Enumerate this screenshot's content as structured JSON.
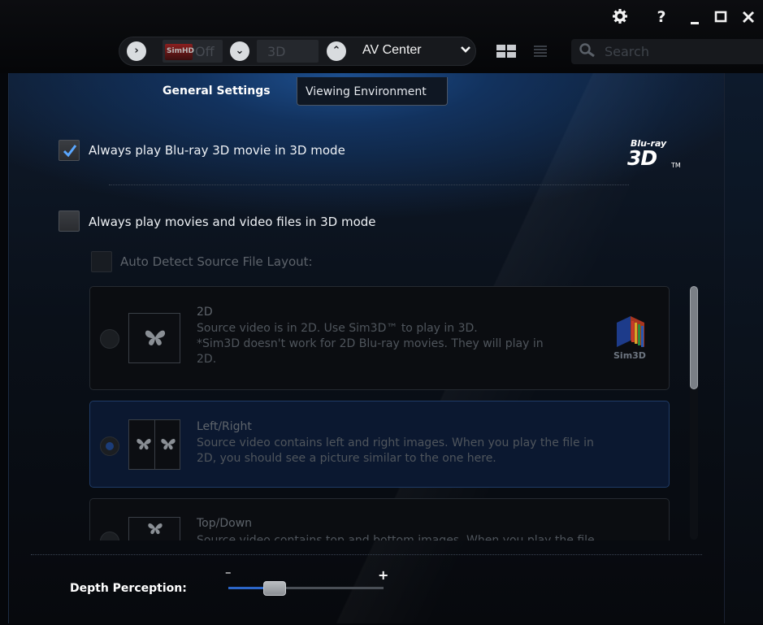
{
  "toolbar": {
    "simhd_logo": "SimHD",
    "simhd_state": "Off",
    "mode_label": "3D",
    "view_selector": "AV Center",
    "search_placeholder": "Search"
  },
  "tabs": [
    {
      "label": "General Settings",
      "active": true
    },
    {
      "label": "Viewing Environment",
      "active": false
    }
  ],
  "options": {
    "bluray_3d": {
      "label": "Always play Blu-ray 3D movie in 3D mode",
      "checked": true
    },
    "movies_3d": {
      "label": "Always play movies and video files in 3D mode",
      "checked": false
    },
    "auto_detect": {
      "label": "Auto Detect Source File Layout:",
      "checked": false,
      "enabled": false
    }
  },
  "bluray_logo": {
    "brand": "Blu-ray",
    "mark": "3D",
    "tm": "TM"
  },
  "layouts": [
    {
      "title": "2D",
      "lines": [
        "Source video is in 2D. Use Sim3D™ to play in 3D.",
        "*Sim3D doesn't work for 2D Blu-ray movies. They will play in",
        "2D."
      ],
      "selected": false,
      "badge": "Sim3D"
    },
    {
      "title": "Left/Right",
      "lines": [
        "Source video contains left and right images. When you play the file in",
        "2D, you should see a picture similar to the one here."
      ],
      "selected": true
    },
    {
      "title": "Top/Down",
      "lines": [
        "Source video contains top and bottom images. When you play the file"
      ],
      "selected": false
    }
  ],
  "depth": {
    "label": "Depth Perception:",
    "minus": "–",
    "plus": "+",
    "value_fraction": 0.3
  },
  "colors": {
    "accent": "#2c66c8",
    "check": "#5aa7ff",
    "panel_glow": "#1d4f8f"
  },
  "icons": [
    "gear-icon",
    "help-icon",
    "minimize-icon",
    "maximize-icon",
    "close-icon",
    "chevron-right-icon",
    "chevron-down-icon",
    "chevron-up-icon",
    "grid-view-icon",
    "list-view-icon",
    "search-icon",
    "butterfly-icon"
  ]
}
